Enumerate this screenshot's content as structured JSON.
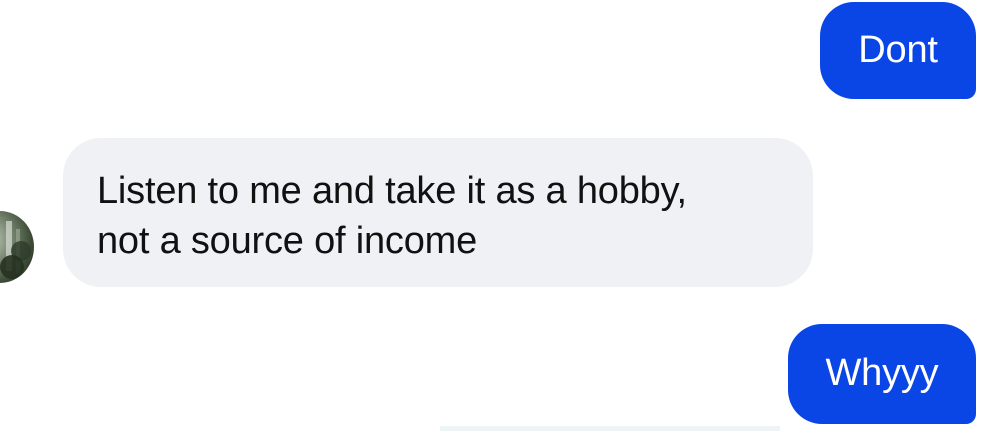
{
  "conversation": {
    "messages": [
      {
        "direction": "outgoing",
        "text": "Dont"
      },
      {
        "direction": "incoming",
        "lines": [
          "Listen to me and take it as a hobby,",
          "not a source of income"
        ]
      },
      {
        "direction": "outgoing",
        "text": "Whyyy"
      }
    ],
    "avatar_icon": "contact-avatar"
  },
  "colors": {
    "outgoing_bubble": "#0a45e6",
    "incoming_bubble": "#f0f1f5",
    "incoming_text": "#111111"
  }
}
